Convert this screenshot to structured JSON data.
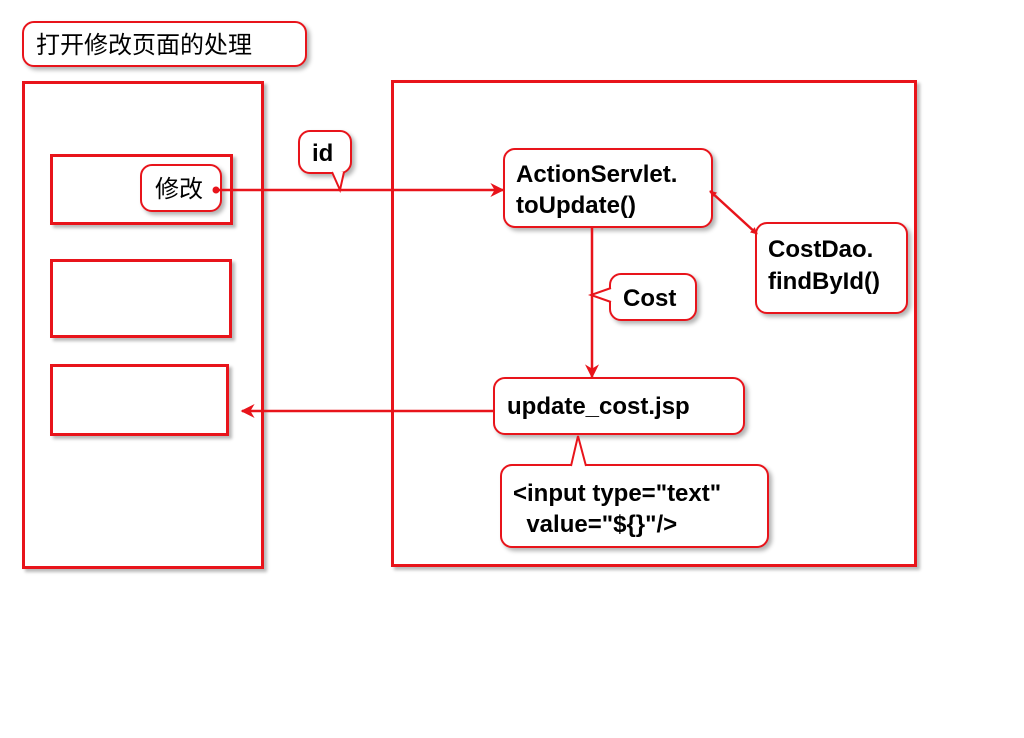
{
  "title": "打开修改页面的处理",
  "colors": {
    "accent": "#e8141b"
  },
  "left_panel": {
    "modify_label": "修改"
  },
  "right_panel": {
    "param_label": "id",
    "servlet_label": "ActionServlet.\ntoUpdate()",
    "dao_label": "CostDao.\nfindById()",
    "entity_label": "Cost",
    "jsp_label": "update_cost.jsp",
    "input_label": "<input type=\"text\"\n  value=\"${}\"/>"
  }
}
